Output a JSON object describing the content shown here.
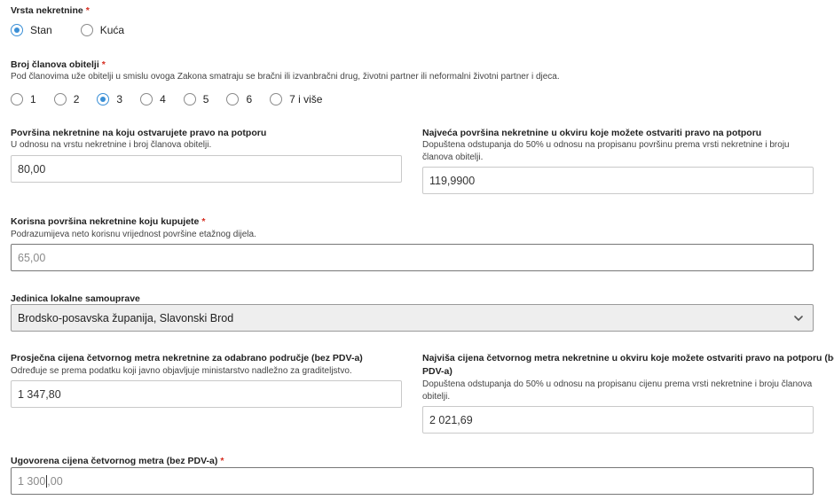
{
  "property_type": {
    "label": "Vrsta nekretnine",
    "required_mark": "*",
    "options": [
      {
        "label": "Stan",
        "checked": true
      },
      {
        "label": "Kuća",
        "checked": false
      }
    ]
  },
  "family_members": {
    "label": "Broj članova obitelji",
    "required_mark": "*",
    "hint": "Pod članovima uže obitelji u smislu ovoga Zakona smatraju se bračni ili izvanbračni drug, životni partner ili neformalni životni partner i djeca.",
    "options": [
      {
        "label": "1",
        "checked": false
      },
      {
        "label": "2",
        "checked": false
      },
      {
        "label": "3",
        "checked": true
      },
      {
        "label": "4",
        "checked": false
      },
      {
        "label": "5",
        "checked": false
      },
      {
        "label": "6",
        "checked": false
      },
      {
        "label": "7 i više",
        "checked": false
      }
    ]
  },
  "eligible_area": {
    "label": "Površina nekretnine na koju ostvarujete pravo na potporu",
    "hint": "U odnosu na vrstu nekretnine i broj članova obitelji.",
    "value": "80,00"
  },
  "max_area": {
    "label": "Najveća površina nekretnine u okviru koje možete ostvariti pravo na potporu",
    "hint": "Dopuštena odstupanja do 50% u odnosu na propisanu površinu prema vrsti nekretnine i broju članova obitelji.",
    "value": "119,9900"
  },
  "usable_area": {
    "label": "Korisna površina nekretnine koju kupujete",
    "required_mark": "*",
    "hint": "Podrazumijeva neto korisnu vrijednost površine etažnog dijela.",
    "value": "65,00"
  },
  "local_unit": {
    "label": "Jedinica lokalne samouprave",
    "value": "Brodsko-posavska županija, Slavonski Brod"
  },
  "avg_price": {
    "label": "Prosječna cijena četvornog metra nekretnine za odabrano područje (bez PDV-a)",
    "hint": "Određuje se prema podatku koji javno objavljuje ministarstvo nadležno za graditeljstvo.",
    "value": "1 347,80"
  },
  "max_price": {
    "label_line1": "Najviša cijena četvornog metra nekretnine u okviru koje možete ostvariti pravo na potporu (bez",
    "label_line2": "PDV-a)",
    "hint": "Dopuštena odstupanja do 50% u odnosu na propisanu cijenu prema vrsti nekretnine i broju članova obitelji.",
    "value": "2 021,69"
  },
  "agreed_price": {
    "label": "Ugovorena cijena četvornog metra (bez PDV-a)",
    "required_mark": "*",
    "value_before_caret": "1 300",
    "value_after_caret": ",00"
  }
}
